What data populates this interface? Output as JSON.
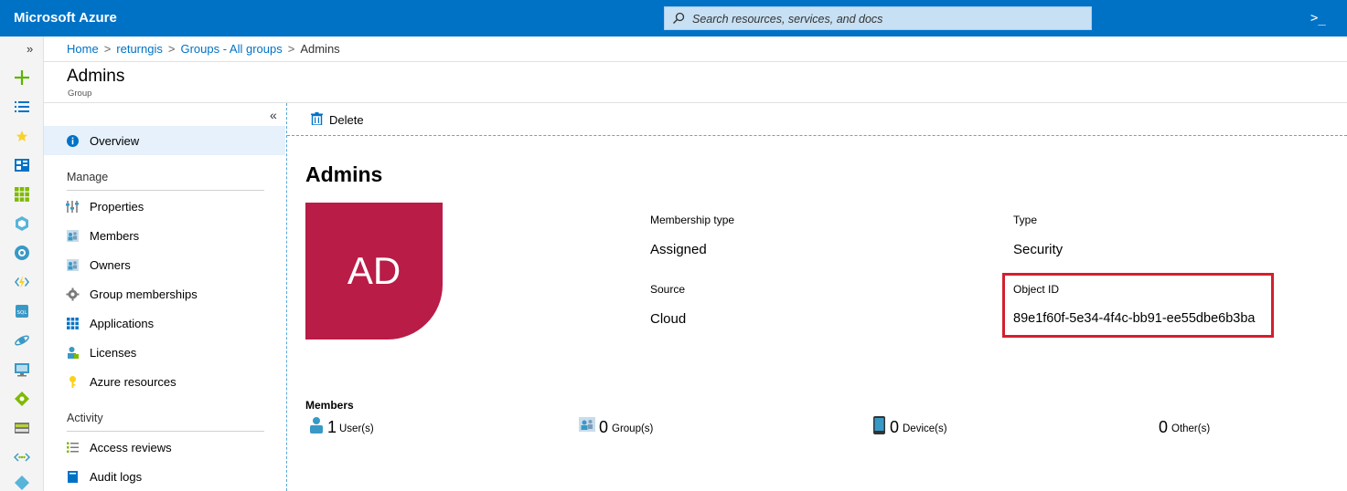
{
  "app": {
    "brand": "Microsoft Azure",
    "search_placeholder": "Search resources, services, and docs",
    "shell_label": ">_"
  },
  "breadcrumb": [
    {
      "label": "Home"
    },
    {
      "label": "returngis"
    },
    {
      "label": "Groups - All groups"
    },
    {
      "label": "Admins"
    }
  ],
  "blade": {
    "title": "Admins",
    "subtitle": "Group"
  },
  "menu": {
    "collapse_label": "«",
    "items": [
      {
        "label": "Overview",
        "icon": "info-icon"
      },
      {
        "label": "Properties",
        "icon": "properties-icon"
      },
      {
        "label": "Members",
        "icon": "members-icon"
      },
      {
        "label": "Owners",
        "icon": "owners-icon"
      },
      {
        "label": "Group memberships",
        "icon": "gear-icon"
      },
      {
        "label": "Applications",
        "icon": "applications-grid-icon"
      },
      {
        "label": "Licenses",
        "icon": "license-user-icon"
      },
      {
        "label": "Azure resources",
        "icon": "key-icon"
      },
      {
        "label": "Access reviews",
        "icon": "list-check-icon"
      },
      {
        "label": "Audit logs",
        "icon": "book-icon"
      }
    ],
    "sections": {
      "manage": "Manage",
      "activity": "Activity"
    }
  },
  "toolbar": {
    "delete_label": "Delete"
  },
  "group": {
    "name": "Admins",
    "initials": "AD",
    "avatar_color": "#b91c46",
    "membership_type_label": "Membership type",
    "membership_type_value": "Assigned",
    "type_label": "Type",
    "type_value": "Security",
    "source_label": "Source",
    "source_value": "Cloud",
    "object_id_label": "Object ID",
    "object_id_value": "89e1f60f-5e34-4f4c-bb91-ee55dbe6b3ba"
  },
  "members": {
    "title": "Members",
    "users_count": "1",
    "users_label": "User(s)",
    "groups_count": "0",
    "groups_label": "Group(s)",
    "devices_count": "0",
    "devices_label": "Device(s)",
    "others_count": "0",
    "others_label": "Other(s)"
  },
  "colors": {
    "topbar": "#0072c6",
    "link": "#0072c6",
    "highlight_border": "#d41f2d"
  }
}
